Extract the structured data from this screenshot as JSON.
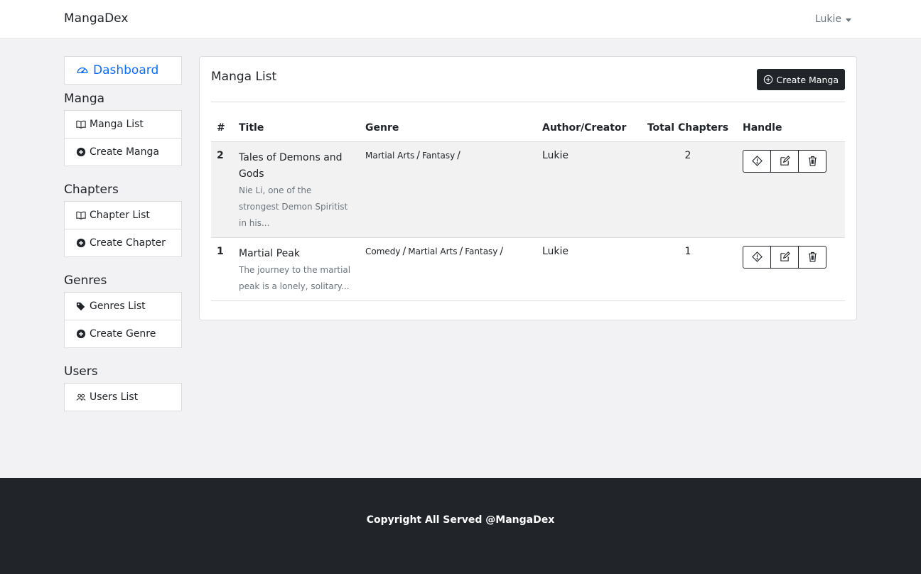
{
  "navbar": {
    "brand": "MangaDex",
    "user": "Lukie"
  },
  "sidebar": {
    "dashboard": "Dashboard",
    "sections": {
      "manga": {
        "title": "Manga",
        "items": [
          "Manga List",
          "Create Manga"
        ]
      },
      "chapters": {
        "title": "Chapters",
        "items": [
          "Chapter List",
          "Create Chapter"
        ]
      },
      "genres": {
        "title": "Genres",
        "items": [
          "Genres List",
          "Create Genre"
        ]
      },
      "users": {
        "title": "Users",
        "items": [
          "Users List"
        ]
      }
    }
  },
  "main": {
    "title": "Manga List",
    "create_button": "Create Manga",
    "columns": [
      "#",
      "Title",
      "Genre",
      "Author/Creator",
      "Total Chapters",
      "Handle"
    ],
    "rows": [
      {
        "id": "2",
        "title": "Tales of Demons and Gods",
        "description": "Nie Li, one of the strongest Demon Spiritist in his...",
        "genres": [
          "Martial Arts",
          "Fantasy"
        ],
        "author": "Lukie",
        "total_chapters": "2"
      },
      {
        "id": "1",
        "title": "Martial Peak",
        "description": "The journey to the martial peak is a lonely, solitary...",
        "genres": [
          "Comedy",
          "Martial Arts",
          "Fantasy"
        ],
        "author": "Lukie",
        "total_chapters": "1"
      }
    ]
  },
  "footer": {
    "text": "Copyright All Served @MangaDex"
  },
  "colors": {
    "accent": "#0d6efd",
    "dark": "#212529",
    "background": "#f2f2f4"
  }
}
